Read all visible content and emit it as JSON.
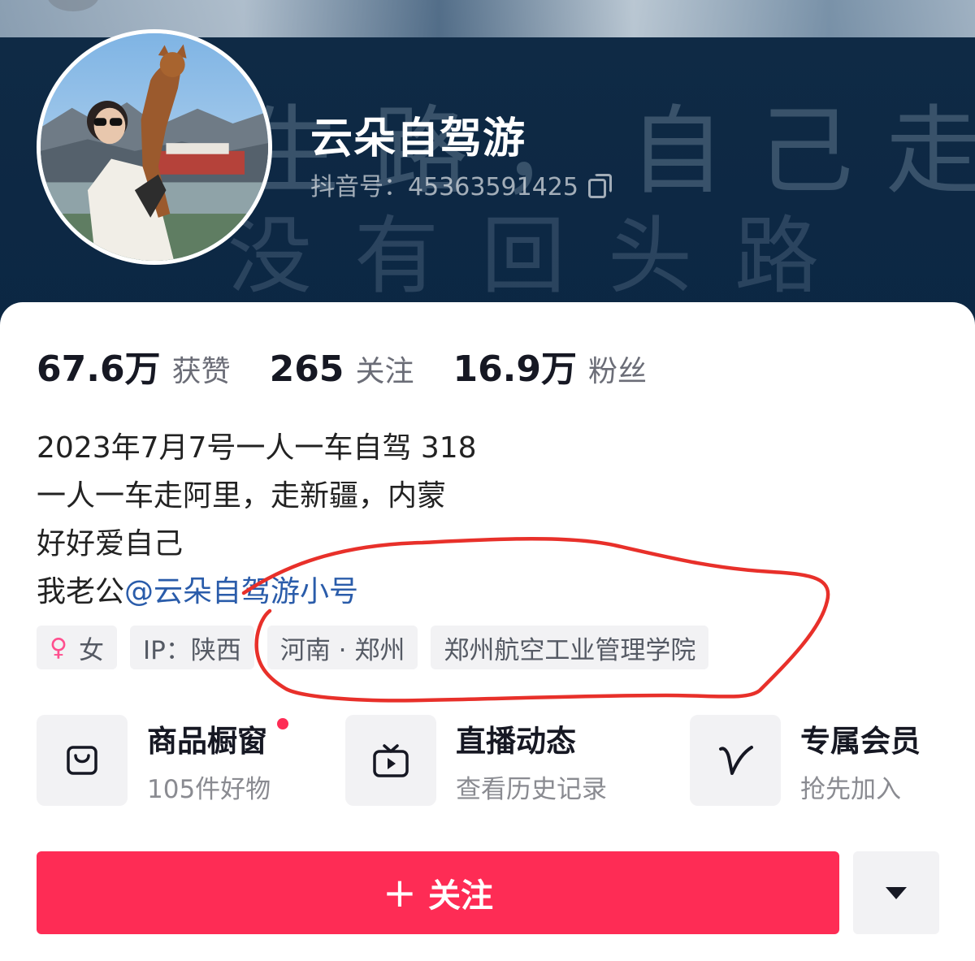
{
  "banner": {
    "calligraphy_line1": "生路，自己走",
    "calligraphy_line2": "没有回头路"
  },
  "profile": {
    "name": "云朵自驾游",
    "douyin_id": "抖音号：45363591425"
  },
  "stats": [
    {
      "value": "67.6万",
      "label": "获赞"
    },
    {
      "value": "265",
      "label": "关注"
    },
    {
      "value": "16.9万",
      "label": "粉丝"
    }
  ],
  "bio": {
    "line1": "2023年7月7号一人一车自驾 318",
    "line2": "一人一车走阿里，走新疆，内蒙",
    "line3": "好好爱自己",
    "line4_prefix": "我老公",
    "line4_mention": "@云朵自驾游小号"
  },
  "tags": {
    "gender": "女",
    "ip": "IP：陕西",
    "location": "河南 · 郑州",
    "school": "郑州航空工业管理学院"
  },
  "services": [
    {
      "title": "商品橱窗",
      "sub": "105件好物",
      "icon": "shopping-bag-icon"
    },
    {
      "title": "直播动态",
      "sub": "查看历史记录",
      "icon": "tv-icon"
    },
    {
      "title": "专属会员",
      "sub": "抢先加入",
      "icon": "v-icon"
    }
  ],
  "actions": {
    "follow_label": "关注",
    "follow_color": "#fe2c55"
  },
  "annotation_color": "#e8302a"
}
